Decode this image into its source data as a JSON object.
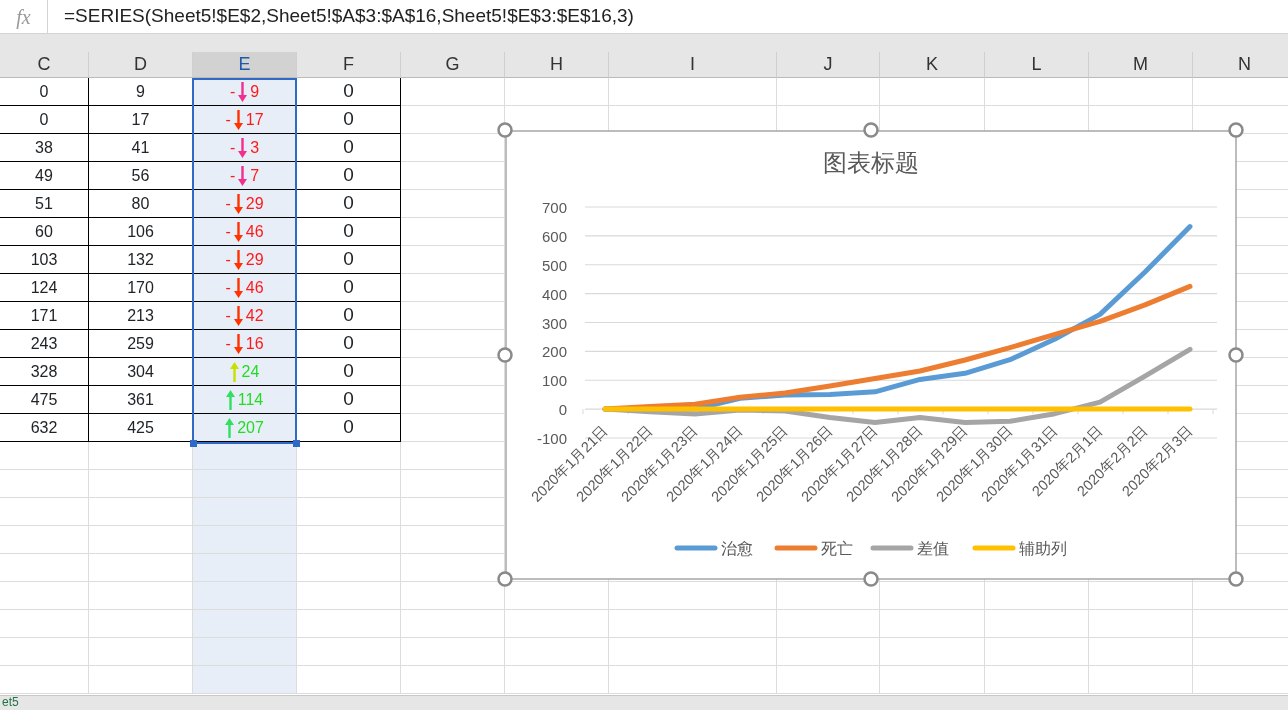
{
  "formula_bar": {
    "function_label": "fx",
    "formula": "=SERIES(Sheet5!$E$2,Sheet5!$A$3:$A$16,Sheet5!$E$3:$E$16,3)"
  },
  "columns": [
    {
      "label": "C",
      "selected": false
    },
    {
      "label": "D",
      "selected": false
    },
    {
      "label": "E",
      "selected": true
    },
    {
      "label": "F",
      "selected": false
    },
    {
      "label": "G",
      "selected": false
    },
    {
      "label": "H",
      "selected": false
    },
    {
      "label": "I",
      "selected": false
    },
    {
      "label": "J",
      "selected": false
    },
    {
      "label": "K",
      "selected": false
    },
    {
      "label": "L",
      "selected": false
    },
    {
      "label": "M",
      "selected": false
    },
    {
      "label": "N",
      "selected": false
    }
  ],
  "rows": [
    {
      "c": "0",
      "d": "9",
      "e": {
        "kind": "down",
        "sign": "-",
        "number": "9",
        "color": "#f0308c"
      },
      "f": "0"
    },
    {
      "c": "0",
      "d": "17",
      "e": {
        "kind": "down",
        "sign": "-",
        "number": "17",
        "color": "#ff3300"
      },
      "f": "0"
    },
    {
      "c": "38",
      "d": "41",
      "e": {
        "kind": "down",
        "sign": "-",
        "number": "3",
        "color": "#f0308c"
      },
      "f": "0"
    },
    {
      "c": "49",
      "d": "56",
      "e": {
        "kind": "down",
        "sign": "-",
        "number": "7",
        "color": "#f0308c"
      },
      "f": "0"
    },
    {
      "c": "51",
      "d": "80",
      "e": {
        "kind": "down",
        "sign": "-",
        "number": "29",
        "color": "#ff3300"
      },
      "f": "0"
    },
    {
      "c": "60",
      "d": "106",
      "e": {
        "kind": "down",
        "sign": "-",
        "number": "46",
        "color": "#ff3300"
      },
      "f": "0"
    },
    {
      "c": "103",
      "d": "132",
      "e": {
        "kind": "down",
        "sign": "-",
        "number": "29",
        "color": "#ff3300"
      },
      "f": "0"
    },
    {
      "c": "124",
      "d": "170",
      "e": {
        "kind": "down",
        "sign": "-",
        "number": "46",
        "color": "#ff3300"
      },
      "f": "0"
    },
    {
      "c": "171",
      "d": "213",
      "e": {
        "kind": "down",
        "sign": "-",
        "number": "42",
        "color": "#ff3300"
      },
      "f": "0"
    },
    {
      "c": "243",
      "d": "259",
      "e": {
        "kind": "down",
        "sign": "-",
        "number": "16",
        "color": "#ff3300"
      },
      "f": "0"
    },
    {
      "c": "328",
      "d": "304",
      "e": {
        "kind": "up",
        "number": "24",
        "color": "#c8e000"
      },
      "f": "0"
    },
    {
      "c": "475",
      "d": "361",
      "e": {
        "kind": "up",
        "number": "114",
        "color": "#30e060"
      },
      "f": "0"
    },
    {
      "c": "632",
      "d": "425",
      "e": {
        "kind": "up",
        "number": "207",
        "color": "#30e060"
      },
      "f": "0"
    }
  ],
  "chart": {
    "chart_data": {
      "type": "line",
      "title": "图表标题",
      "categories": [
        "2020年1月21日",
        "2020年1月22日",
        "2020年1月23日",
        "2020年1月24日",
        "2020年1月25日",
        "2020年1月26日",
        "2020年1月27日",
        "2020年1月28日",
        "2020年1月29日",
        "2020年1月30日",
        "2020年1月31日",
        "2020年2月1日",
        "2020年2月2日",
        "2020年2月3日"
      ],
      "series": [
        {
          "name": "治愈",
          "color": "#5b9bd5",
          "values": [
            0,
            0,
            0,
            38,
            49,
            51,
            60,
            103,
            124,
            171,
            243,
            328,
            475,
            632
          ]
        },
        {
          "name": "死亡",
          "color": "#ed7d31",
          "values": [
            0,
            9,
            17,
            41,
            56,
            80,
            106,
            132,
            170,
            213,
            259,
            304,
            361,
            425
          ]
        },
        {
          "name": "差值",
          "color": "#a5a5a5",
          "values": [
            0,
            -9,
            -17,
            -3,
            -7,
            -29,
            -46,
            -29,
            -46,
            -42,
            -16,
            24,
            114,
            207
          ]
        },
        {
          "name": "辅助列",
          "color": "#ffc000",
          "values": [
            0,
            0,
            0,
            0,
            0,
            0,
            0,
            0,
            0,
            0,
            0,
            0,
            0,
            0
          ]
        }
      ],
      "ylim": [
        -100,
        700
      ],
      "yticks": [
        -100,
        0,
        100,
        200,
        300,
        400,
        500,
        600,
        700
      ],
      "grid": true,
      "legend": true
    }
  },
  "sheet_tab": "et5"
}
